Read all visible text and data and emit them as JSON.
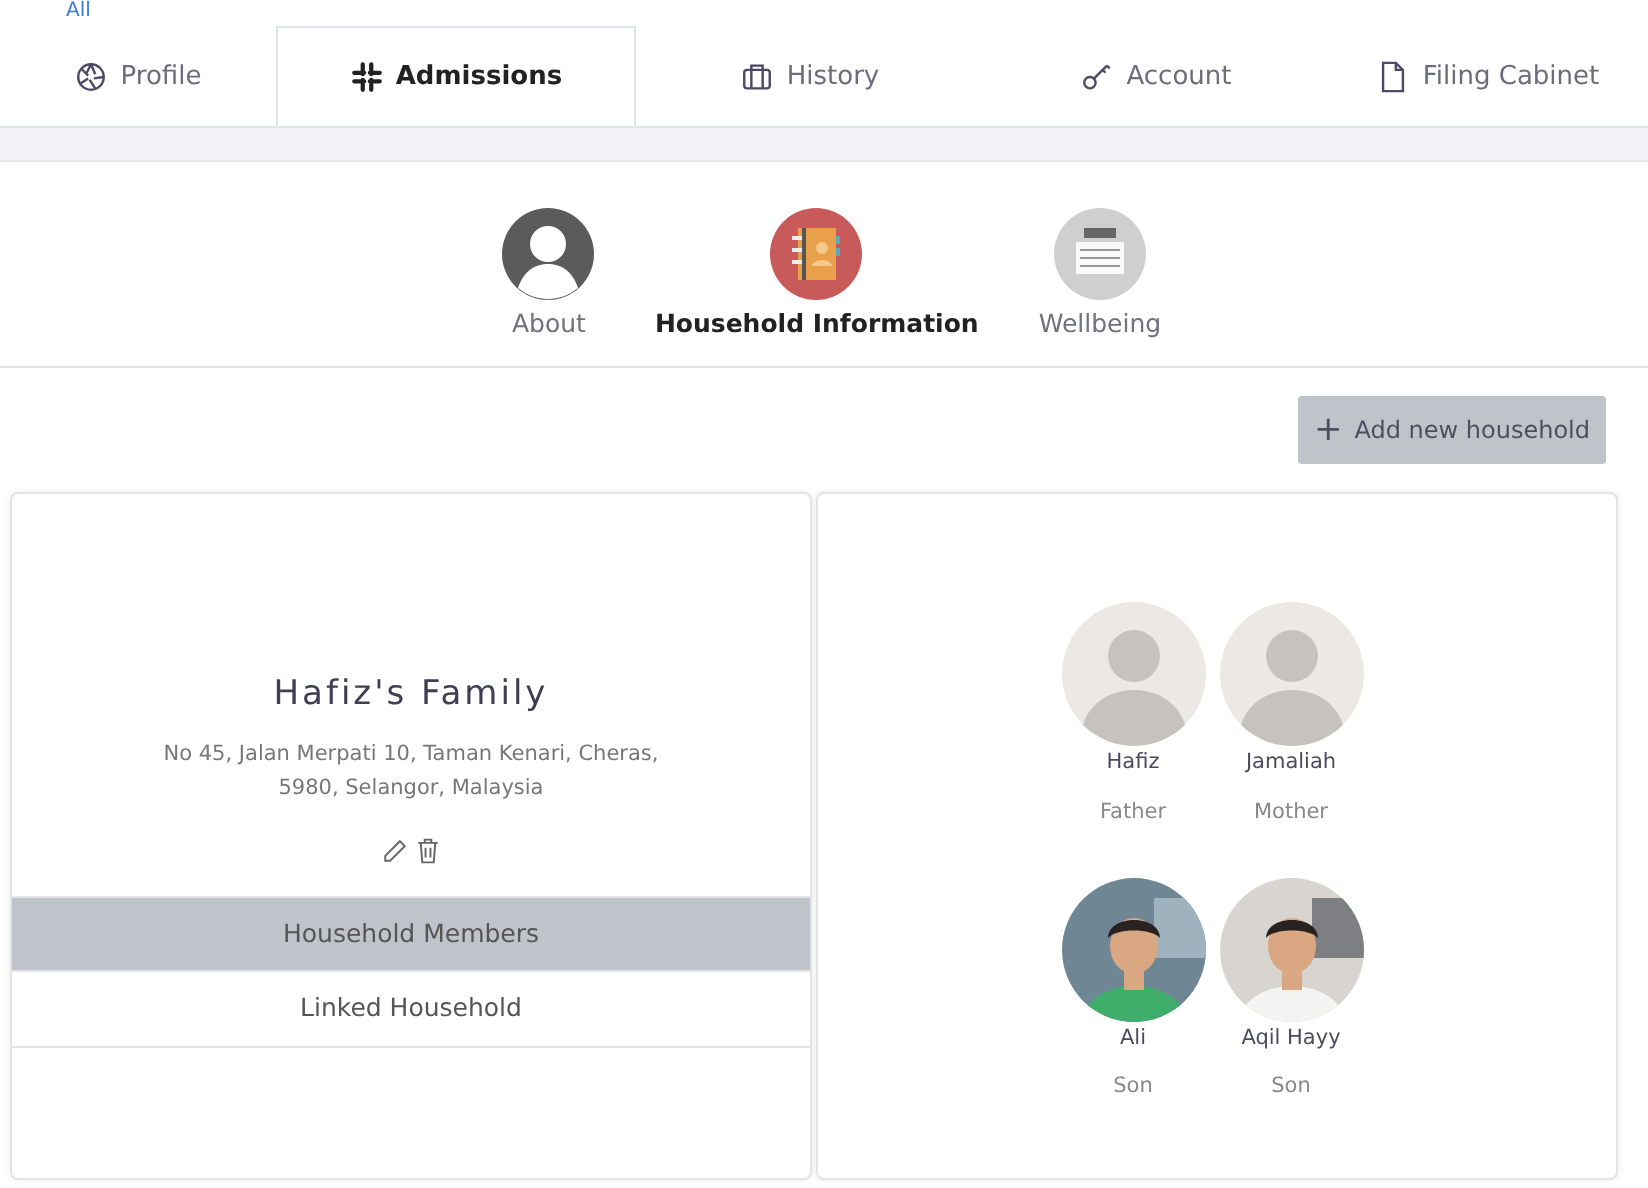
{
  "header_link": "All",
  "tabs": [
    {
      "label": "Profile",
      "selected": false
    },
    {
      "label": "Admissions",
      "selected": true
    },
    {
      "label": "History",
      "selected": false
    },
    {
      "label": "Account",
      "selected": false
    },
    {
      "label": "Filing Cabinet",
      "selected": false
    }
  ],
  "sections": [
    {
      "label": "About",
      "selected": false
    },
    {
      "label": "Household Information",
      "selected": true
    },
    {
      "label": "Wellbeing",
      "selected": false
    }
  ],
  "add_button": {
    "icon": "+",
    "label": "Add new household"
  },
  "household": {
    "name": "Hafiz's Family",
    "address": "No 45, Jalan Merpati 10, Taman Kenari, Cheras, 5980, Selangor, Malaysia",
    "menu": [
      {
        "label": "Household Members",
        "selected": true
      },
      {
        "label": "Linked Household",
        "selected": false
      }
    ]
  },
  "members": [
    {
      "name": "Hafiz",
      "relation": "Father",
      "kind": "placeholder"
    },
    {
      "name": "Jamaliah",
      "relation": "Mother",
      "kind": "placeholder"
    },
    {
      "name": "Ali",
      "relation": "Son"
    },
    {
      "name": "Aqil Hayy",
      "relation": "Son"
    }
  ]
}
